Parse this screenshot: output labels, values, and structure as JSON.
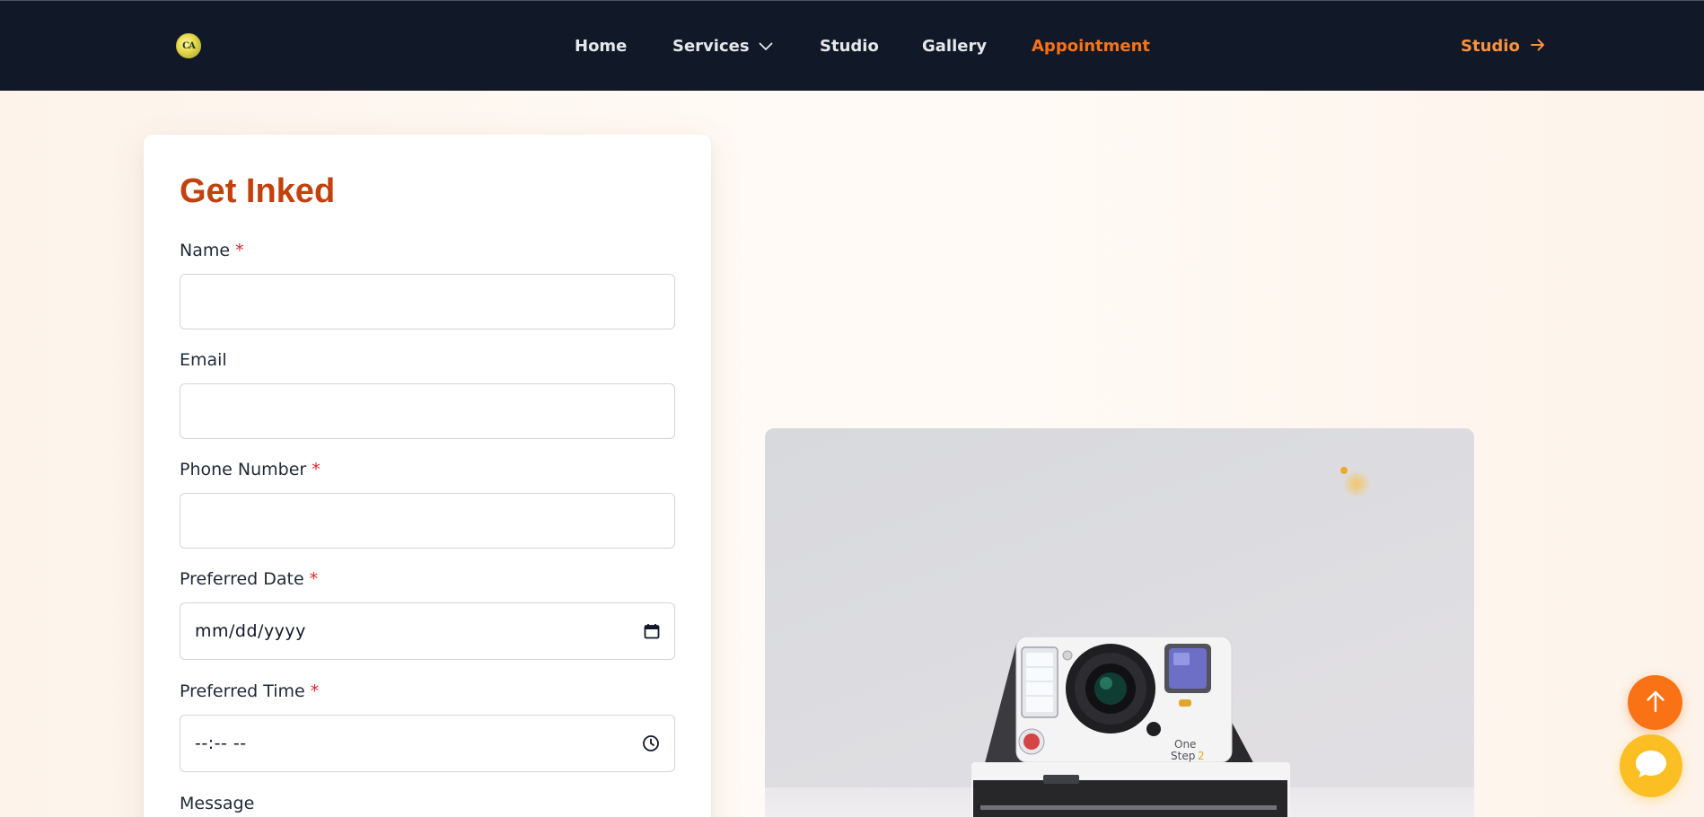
{
  "nav": {
    "logo_text": "CA",
    "links": [
      "Home",
      "Services",
      "Studio",
      "Gallery",
      "Appointment"
    ],
    "cta_label": "Studio",
    "active": "Appointment"
  },
  "form": {
    "title": "Get Inked",
    "required_mark": "*",
    "fields": [
      {
        "label": "Name",
        "required": true,
        "value": ""
      },
      {
        "label": "Email",
        "required": false,
        "value": ""
      },
      {
        "label": "Phone Number",
        "required": true,
        "value": ""
      },
      {
        "label": "Preferred Date",
        "required": true,
        "placeholder": "mm/dd/yyyy"
      },
      {
        "label": "Preferred Time",
        "required": true,
        "placeholder": "--:-- --"
      },
      {
        "label": "Message",
        "required": false
      }
    ]
  },
  "photo": {
    "camera_label_line1": "One",
    "camera_label_line2": "Step",
    "camera_label_num": "2"
  },
  "icons": {
    "services_chevron": "chevron-down-icon",
    "cta_arrow": "arrow-right-icon",
    "date_icon": "calendar-icon",
    "time_icon": "clock-icon",
    "scroll_top": "arrow-up-icon",
    "chat": "chat-bubble-icon"
  },
  "colors": {
    "navbar_bg": "#111827",
    "accent_orange": "#f97316",
    "title_rust": "#c2410c",
    "chat_yellow": "#fbbf24",
    "required_red": "#dc2626"
  }
}
